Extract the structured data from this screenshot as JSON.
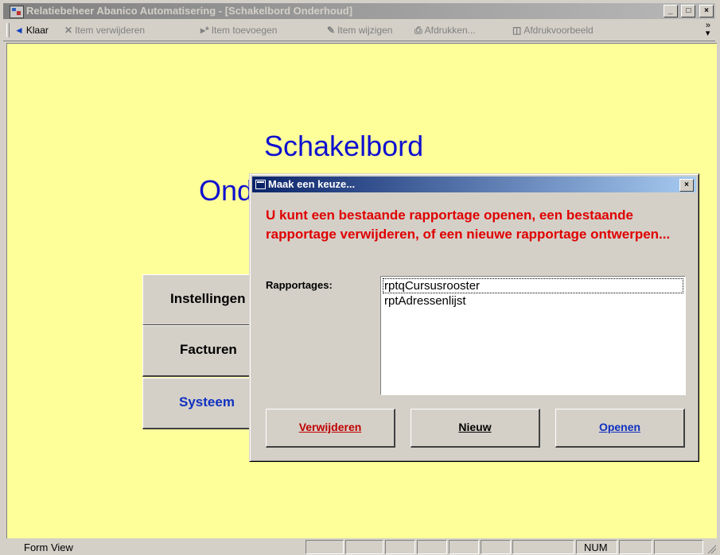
{
  "window": {
    "title": "Relatiebeheer Abanico Automatisering - [Schakelbord Onderhoud]",
    "minimize_glyph": "_",
    "maximize_glyph": "□",
    "close_glyph": "×"
  },
  "toolbar": {
    "items": [
      {
        "label": "Klaar",
        "icon": "back-arrow-icon",
        "enabled": true
      },
      {
        "label": "Item verwijderen",
        "icon": "delete-item-icon",
        "enabled": false
      },
      {
        "label": "Item toevoegen",
        "icon": "add-item-icon",
        "enabled": false
      },
      {
        "label": "Item wijzigen",
        "icon": "edit-item-icon",
        "enabled": false
      },
      {
        "label": "Afdrukken...",
        "icon": "printer-icon",
        "enabled": false
      },
      {
        "label": "Afdrukvoorbeeld",
        "icon": "print-preview-icon",
        "enabled": false
      }
    ],
    "overflow_glyph": "»"
  },
  "form": {
    "title_line1": "Schakelbord",
    "title_line2": "Onderhoud",
    "buttons": [
      "Instellingen",
      "Facturen",
      "Systeem"
    ]
  },
  "dialog": {
    "title": "Maak een keuze...",
    "close_glyph": "×",
    "message": "U kunt een bestaande rapportage openen, een bestaande rapportage verwijderen, of een nieuwe rapportage ontwerpen...",
    "list_label": "Rapportages:",
    "reports": [
      "rptqCursusrooster",
      "rptAdressenlijst"
    ],
    "buttons": {
      "delete": "Verwijderen",
      "new": "Nieuw",
      "open": "Openen"
    }
  },
  "status": {
    "mode": "Form View",
    "num": "NUM"
  }
}
